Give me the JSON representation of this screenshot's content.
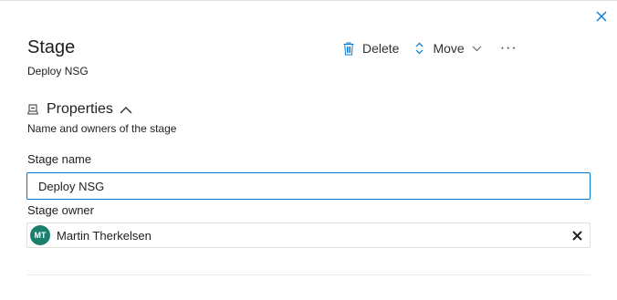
{
  "panel": {
    "title": "Stage",
    "subtitle": "Deploy NSG"
  },
  "toolbar": {
    "delete_label": "Delete",
    "move_label": "Move",
    "more_label": "···"
  },
  "properties": {
    "title": "Properties",
    "description": "Name and owners of the stage"
  },
  "stage_name": {
    "label": "Stage name",
    "value": "Deploy NSG"
  },
  "stage_owner": {
    "label": "Stage owner",
    "initials": "MT",
    "name": "Martin Therkelsen"
  },
  "colors": {
    "accent": "#0078d4",
    "avatar": "#1b7f6e"
  },
  "icons": {
    "close": "close-icon",
    "delete": "trash-icon",
    "move": "up-down-arrows-icon",
    "move_dropdown": "chevron-down-icon",
    "properties": "stage-icon",
    "collapse": "chevron-up-icon",
    "remove_owner": "close-icon"
  }
}
